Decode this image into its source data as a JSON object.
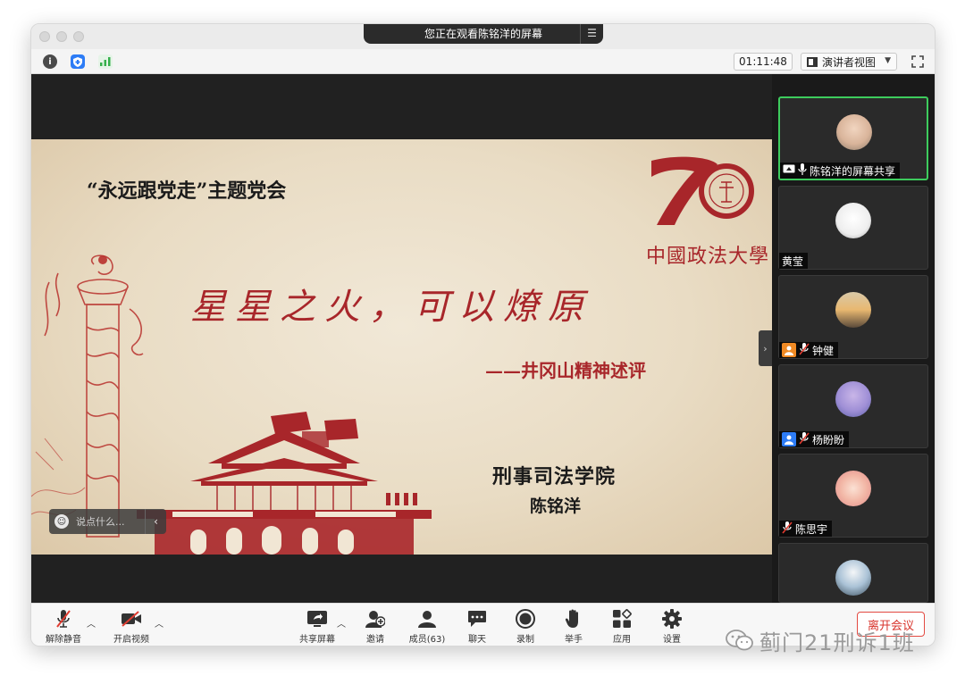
{
  "window": {
    "title_banner": "您正在观看陈铭洋的屏幕",
    "timer": "01:11:48",
    "view_mode": "演讲者视图"
  },
  "slide": {
    "meeting_title": "“永远跟党走”主题党会",
    "headline": "星星之火，可以燎原",
    "subtitle": "——井冈山精神述评",
    "school": "刑事司法学院",
    "presenter": "陈铭洋",
    "university_logo_text": "中國政法大學",
    "logo_numeral": "70"
  },
  "chat": {
    "placeholder": "说点什么..."
  },
  "participants": [
    {
      "name": "陈铭洋的屏幕共享",
      "active": true,
      "sharing": true
    },
    {
      "name": "黄莹",
      "active": false
    },
    {
      "name": "钟健",
      "active": false,
      "muted": true,
      "tag_color": "#f08a24"
    },
    {
      "name": "杨盼盼",
      "active": false,
      "muted": true,
      "tag_color": "#2d7cf6"
    },
    {
      "name": "陈思宇",
      "active": false,
      "muted": true
    },
    {
      "name": "",
      "active": false
    }
  ],
  "toolbar": {
    "unmute": "解除静音",
    "start_video": "开启视频",
    "share_screen": "共享屏幕",
    "invite": "邀请",
    "participants": "成员(63)",
    "chat": "聊天",
    "record": "录制",
    "raise_hand": "举手",
    "apps": "应用",
    "settings": "设置",
    "leave": "离开会议"
  },
  "watermark": "蓟门21刑诉1班",
  "colors": {
    "accent_green": "#3dcc5d",
    "leave_red": "#d8342c",
    "slide_red": "#a8262a"
  }
}
